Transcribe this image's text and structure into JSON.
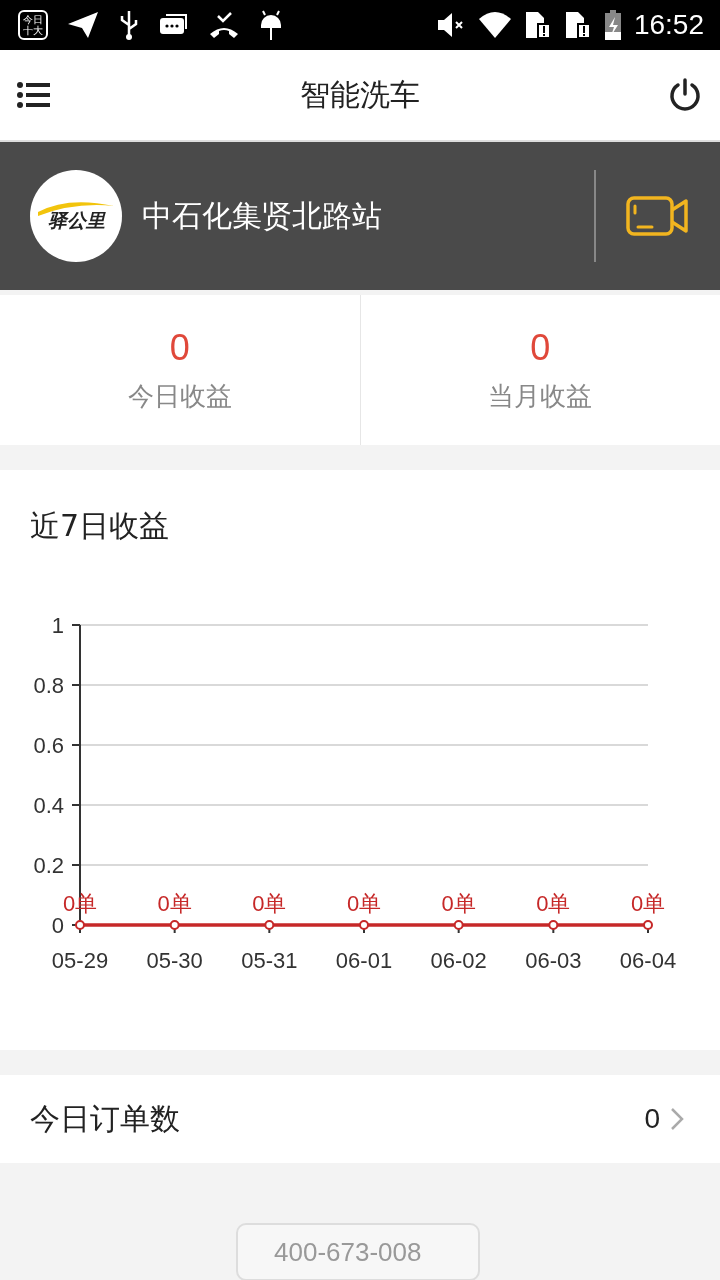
{
  "status_bar": {
    "badge_lines": [
      "今日",
      "十大"
    ],
    "time": "16:52"
  },
  "app_bar": {
    "title": "智能洗车"
  },
  "station": {
    "logo_text": "驿公里",
    "name": "中石化集贤北路站"
  },
  "stats": [
    {
      "value": "0",
      "label": "今日收益"
    },
    {
      "value": "0",
      "label": "当月收益"
    }
  ],
  "chart_card": {
    "title": "近7日收益",
    "chart_data": {
      "type": "line",
      "categories": [
        "05-29",
        "05-30",
        "05-31",
        "06-01",
        "06-02",
        "06-03",
        "06-04"
      ],
      "grid": true,
      "series": [
        {
          "color": "#c62828",
          "marker": "circle",
          "values": [
            0,
            0,
            0,
            0,
            0,
            0,
            0
          ]
        }
      ],
      "ylim": [
        0,
        1
      ],
      "yticks": [
        0,
        0.2,
        0.4,
        0.6,
        0.8,
        {
          "value": 1,
          "label": "1"
        }
      ],
      "value_labels": [
        "0单",
        "0单",
        "0单",
        "0单",
        "0单",
        "0单",
        "0单"
      ]
    }
  },
  "orders_row": {
    "label": "今日订单数",
    "value": "0"
  },
  "phone_button": {
    "label": "400-673-008"
  }
}
